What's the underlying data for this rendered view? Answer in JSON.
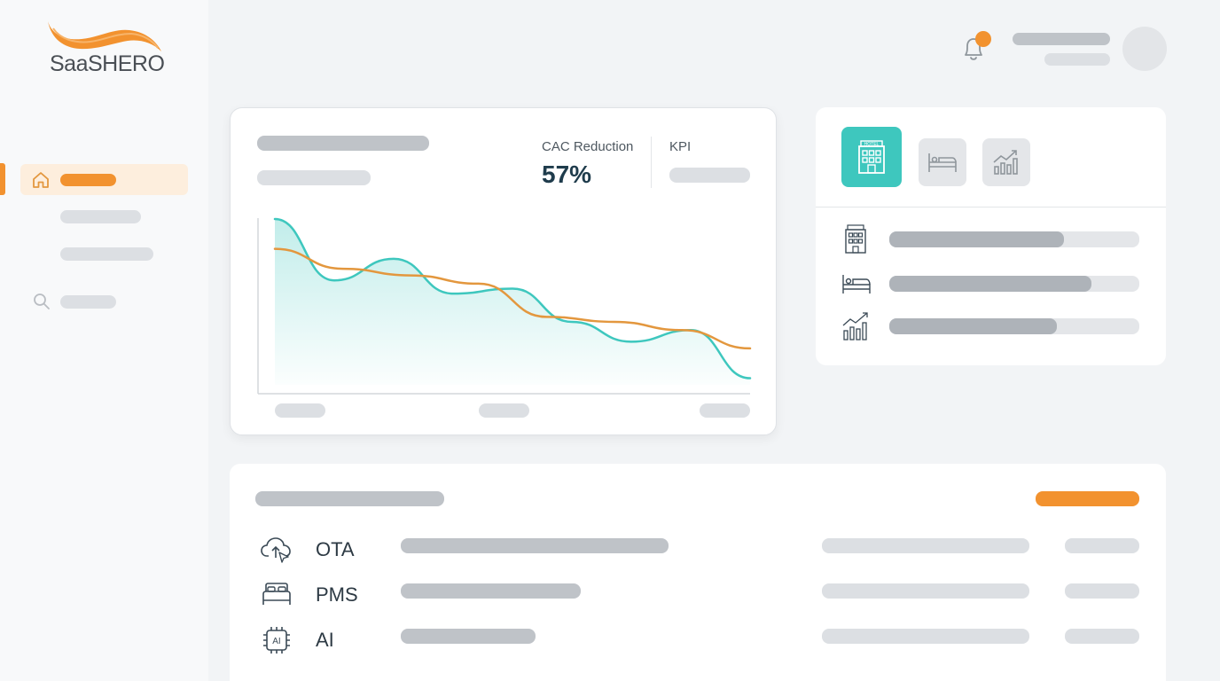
{
  "brand": {
    "name": "SaaSHERO",
    "accent": "#f2922f",
    "teal": "#3ec7be"
  },
  "sidebar": {
    "items": [
      {
        "icon": "home-icon",
        "active": true
      },
      {
        "icon": "none",
        "active": false
      },
      {
        "icon": "none",
        "active": false
      },
      {
        "icon": "search-icon",
        "active": false
      }
    ]
  },
  "header": {
    "has_notification": true
  },
  "kpi_card": {
    "metric_label": "CAC Reduction",
    "metric_value": "57%",
    "secondary_label": "KPI"
  },
  "chart_data": {
    "type": "area",
    "title": "",
    "xlabel": "",
    "ylabel": "",
    "series": [
      {
        "values": [
          100,
          63,
          76,
          55,
          58,
          38,
          26,
          33,
          4
        ],
        "color": "#3ec7be"
      },
      {
        "values": [
          82,
          70,
          66,
          61,
          41,
          38,
          33,
          22
        ],
        "color": "#e3973e"
      }
    ]
  },
  "right_card": {
    "tabs": [
      {
        "icon": "hotel-icon",
        "label": "HOTEL",
        "active": true
      },
      {
        "icon": "bed-icon",
        "active": false
      },
      {
        "icon": "growth-chart-icon",
        "active": false
      }
    ],
    "rows": [
      {
        "icon": "hotel-icon",
        "progress": 0.7
      },
      {
        "icon": "bed-icon",
        "progress": 0.81
      },
      {
        "icon": "growth-chart-icon",
        "progress": 0.67
      }
    ]
  },
  "integrations": {
    "rows": [
      {
        "icon": "cloud-upload-icon",
        "label": "OTA"
      },
      {
        "icon": "bed-icon",
        "label": "PMS"
      },
      {
        "icon": "ai-chip-icon",
        "label": "AI"
      }
    ]
  }
}
